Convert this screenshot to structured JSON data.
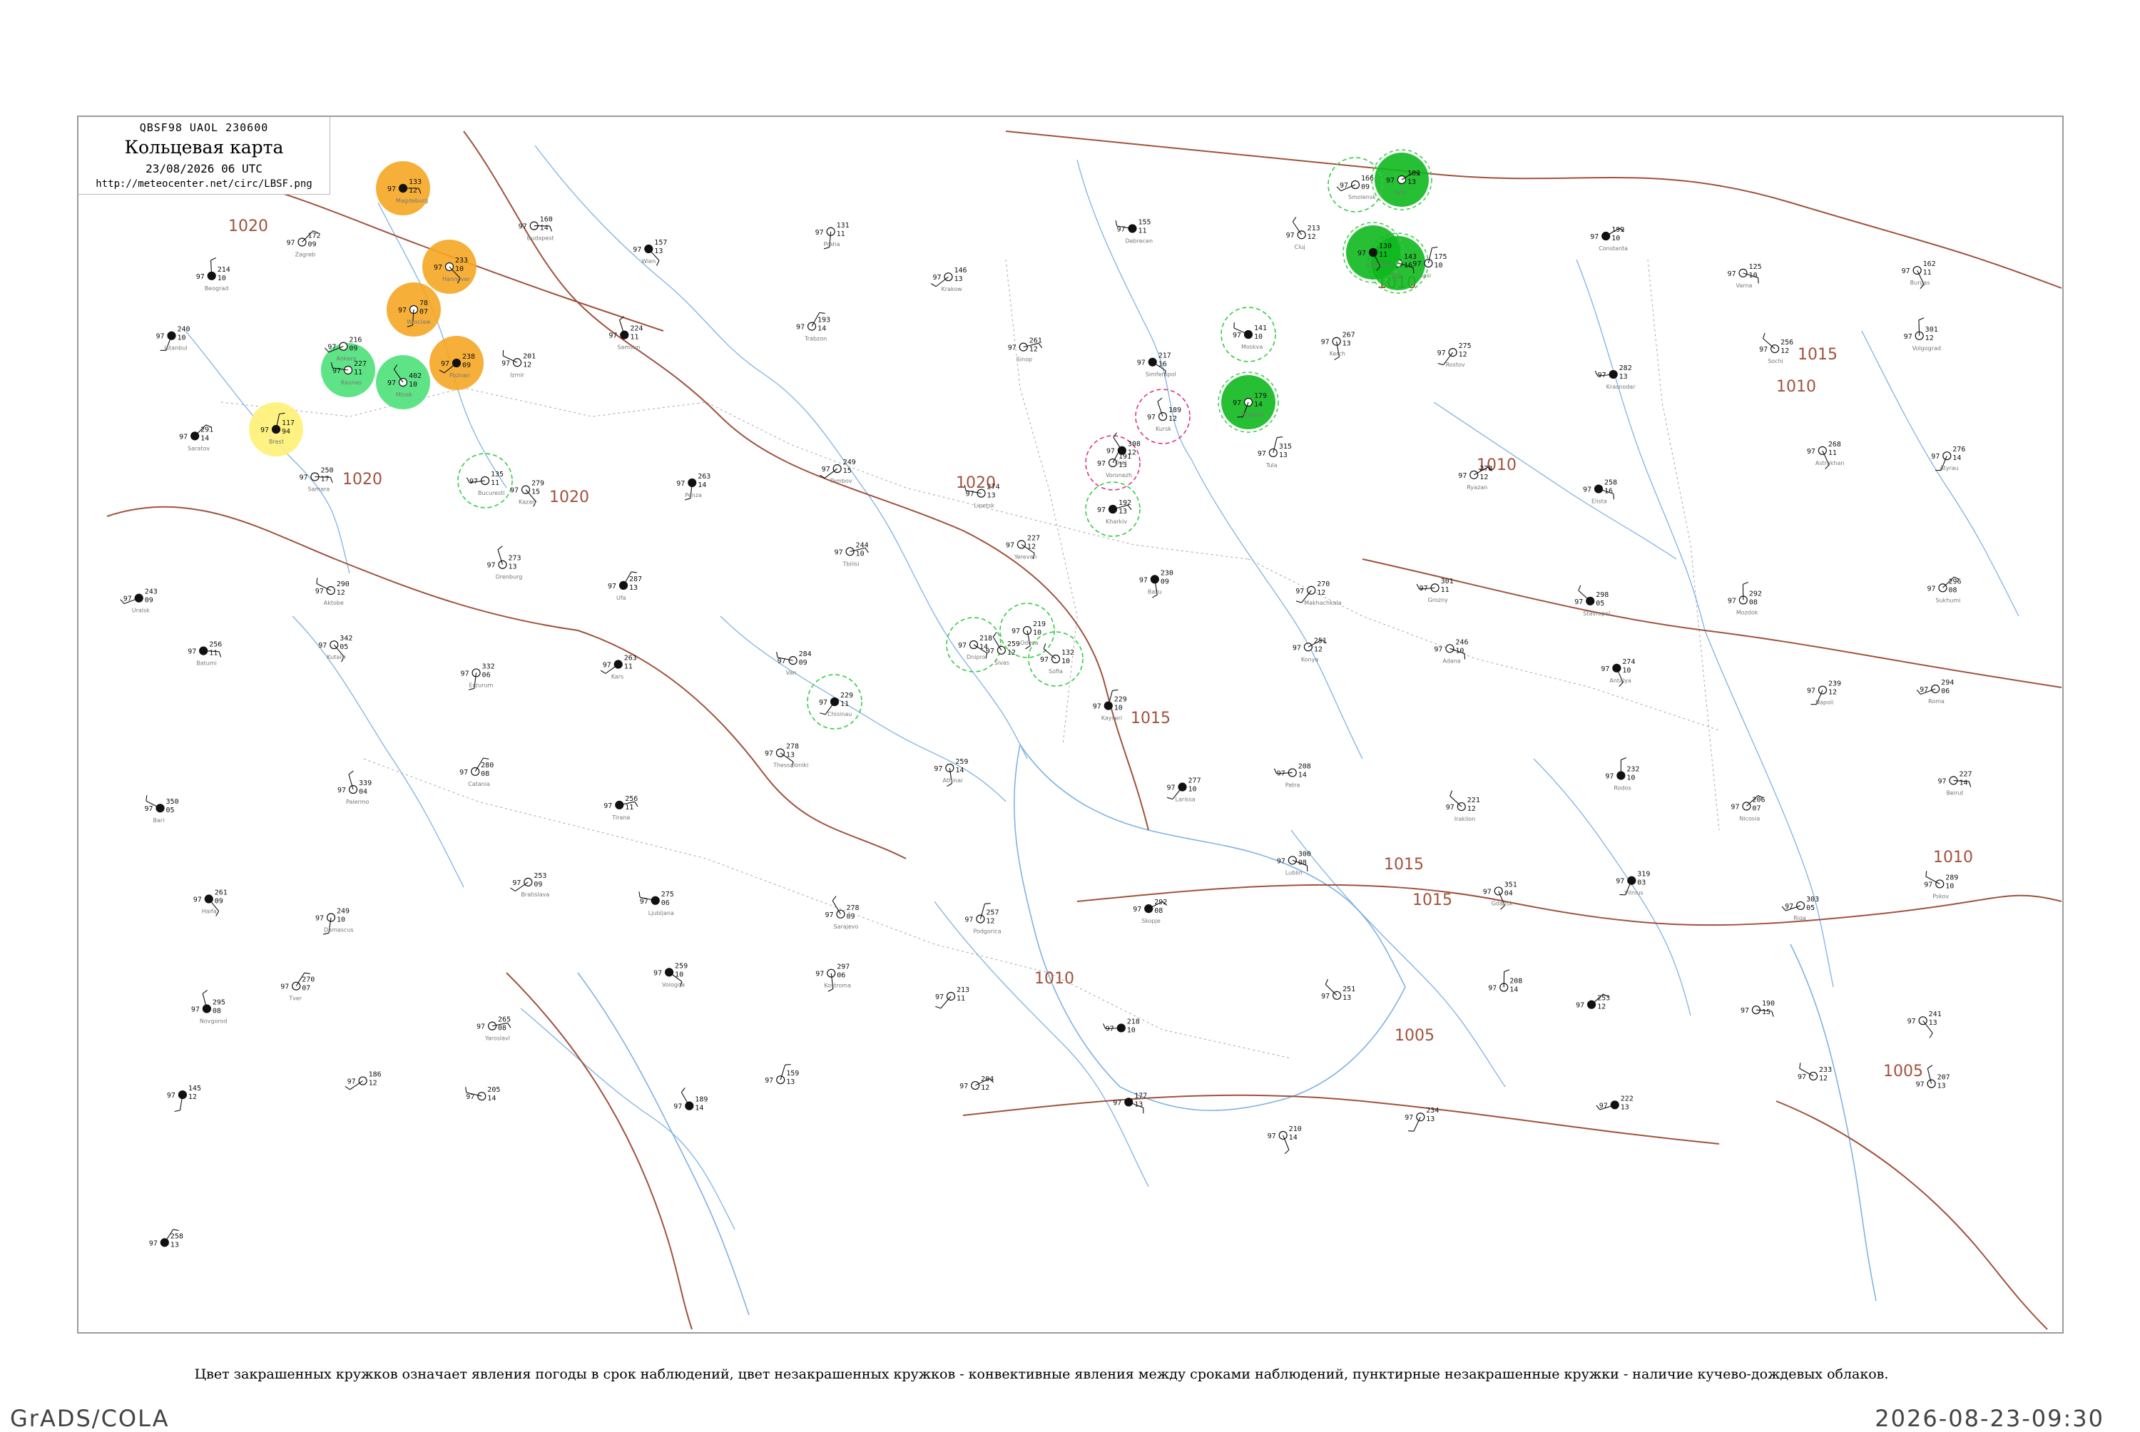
{
  "header": {
    "code": "QBSF98  UAOL  230600",
    "map_name": "Кольцевая карта",
    "datetime": "23/08/2026 06 UTC",
    "url": "http://meteocenter.net/circ/LBSF.png"
  },
  "caption": "Цвет закрашенных кружков означает явления погоды в срок наблюдений, цвет незакрашенных кружков - конвективные явления между сроками наблюдений, пунктирные незакрашенные кружки - наличие кучево-дождевых облаков.",
  "footer": {
    "left": "GrADS/COLA",
    "right": "2026-08-23-09:30"
  },
  "colors": {
    "isobar": "#a0523c",
    "river": "#7fb2e5",
    "border": "#999999",
    "frame": "#9c9c9c",
    "fill_orange": "#f5a623",
    "fill_lightgreen": "#4ee07a",
    "fill_yellow": "#fff176",
    "fill_green": "#0fb81e",
    "ring_green": "#33cc44",
    "ring_magenta": "#dd3388"
  },
  "isobars": [
    {
      "label": "1020"
    },
    {
      "label": "1020"
    },
    {
      "label": "1020"
    },
    {
      "label": "1020"
    },
    {
      "label": "1015"
    },
    {
      "label": "1015"
    },
    {
      "label": "1015"
    },
    {
      "label": "1015"
    },
    {
      "label": "1010"
    },
    {
      "label": "1010"
    },
    {
      "label": "1010"
    },
    {
      "label": "1010"
    },
    {
      "label": "1010"
    },
    {
      "label": "1005"
    },
    {
      "label": "1005"
    }
  ],
  "stations": [
    {
      "p": "133",
      "t": "97",
      "d": "12",
      "c": "orange-fill"
    },
    {
      "p": "233",
      "t": "97",
      "d": "10",
      "c": "orange-fill"
    },
    {
      "p": "78",
      "t": "97",
      "d": "07",
      "c": "orange-fill"
    },
    {
      "p": "238",
      "t": "97",
      "d": "09",
      "c": "orange-fill"
    },
    {
      "p": "227",
      "t": "97",
      "d": "11",
      "c": "lightgreen-fill"
    },
    {
      "p": "402",
      "t": "97",
      "d": "10",
      "c": "lightgreen-fill"
    },
    {
      "p": "117",
      "t": "97",
      "d": "94",
      "c": "yellow-fill"
    },
    {
      "p": "163",
      "t": "97",
      "d": "13",
      "c": "green-fill"
    },
    {
      "p": "143",
      "t": "97",
      "d": "16",
      "c": "green-fill"
    },
    {
      "p": "130",
      "t": "97",
      "d": "11",
      "c": "green-fill"
    },
    {
      "p": "179",
      "t": "97",
      "d": "14",
      "c": "green-fill"
    },
    {
      "p": "166",
      "t": "97",
      "d": "09",
      "c": "ring-green"
    },
    {
      "p": "141",
      "t": "97",
      "d": "10",
      "c": "ring-green"
    },
    {
      "p": "189",
      "t": "97",
      "d": "12",
      "c": "ring-magenta"
    },
    {
      "p": "191",
      "t": "97",
      "d": "13",
      "c": "ring-magenta"
    },
    {
      "p": "192",
      "t": "97",
      "d": "13",
      "c": "ring-green"
    },
    {
      "p": "218",
      "t": "97",
      "d": "14",
      "c": "ring-green"
    },
    {
      "p": "219",
      "t": "97",
      "d": "10",
      "c": "ring-green"
    },
    {
      "p": "229",
      "t": "97",
      "d": "11",
      "c": "ring-green"
    },
    {
      "p": "135",
      "t": "97",
      "d": "11",
      "c": "ring-green"
    },
    {
      "p": "132",
      "t": "97",
      "d": "10",
      "c": "ring-green"
    },
    {
      "p": "214",
      "t": "97",
      "d": "10",
      "c": "plain"
    },
    {
      "p": "172",
      "t": "97",
      "d": "09",
      "c": "plain"
    },
    {
      "p": "160",
      "t": "97",
      "d": "14",
      "c": "plain"
    },
    {
      "p": "157",
      "t": "97",
      "d": "13",
      "c": "plain"
    },
    {
      "p": "131",
      "t": "97",
      "d": "11",
      "c": "plain"
    },
    {
      "p": "146",
      "t": "97",
      "d": "13",
      "c": "plain"
    },
    {
      "p": "155",
      "t": "97",
      "d": "11",
      "c": "plain"
    },
    {
      "p": "213",
      "t": "97",
      "d": "12",
      "c": "plain"
    },
    {
      "p": "175",
      "t": "97",
      "d": "10",
      "c": "plain"
    },
    {
      "p": "199",
      "t": "97",
      "d": "10",
      "c": "plain"
    },
    {
      "p": "125",
      "t": "97",
      "d": "10",
      "c": "plain"
    },
    {
      "p": "162",
      "t": "97",
      "d": "11",
      "c": "plain"
    },
    {
      "p": "240",
      "t": "97",
      "d": "10",
      "c": "plain"
    },
    {
      "p": "216",
      "t": "97",
      "d": "09",
      "c": "plain"
    },
    {
      "p": "201",
      "t": "97",
      "d": "12",
      "c": "plain"
    },
    {
      "p": "224",
      "t": "97",
      "d": "11",
      "c": "plain"
    },
    {
      "p": "193",
      "t": "97",
      "d": "14",
      "c": "plain"
    },
    {
      "p": "261",
      "t": "97",
      "d": "12",
      "c": "plain"
    },
    {
      "p": "217",
      "t": "97",
      "d": "16",
      "c": "plain"
    },
    {
      "p": "267",
      "t": "97",
      "d": "13",
      "c": "plain"
    },
    {
      "p": "275",
      "t": "97",
      "d": "12",
      "c": "plain"
    },
    {
      "p": "282",
      "t": "97",
      "d": "13",
      "c": "plain"
    },
    {
      "p": "256",
      "t": "97",
      "d": "12",
      "c": "plain"
    },
    {
      "p": "301",
      "t": "97",
      "d": "12",
      "c": "plain"
    },
    {
      "p": "291",
      "t": "97",
      "d": "14",
      "c": "plain"
    },
    {
      "p": "250",
      "t": "97",
      "d": "17",
      "c": "plain"
    },
    {
      "p": "279",
      "t": "97",
      "d": "15",
      "c": "plain"
    },
    {
      "p": "263",
      "t": "97",
      "d": "14",
      "c": "plain"
    },
    {
      "p": "249",
      "t": "97",
      "d": "15",
      "c": "plain"
    },
    {
      "p": "274",
      "t": "97",
      "d": "13",
      "c": "plain"
    },
    {
      "p": "308",
      "t": "97",
      "d": "12",
      "c": "plain"
    },
    {
      "p": "315",
      "t": "97",
      "d": "13",
      "c": "plain"
    },
    {
      "p": "278",
      "t": "97",
      "d": "12",
      "c": "plain"
    },
    {
      "p": "258",
      "t": "97",
      "d": "16",
      "c": "plain"
    },
    {
      "p": "268",
      "t": "97",
      "d": "11",
      "c": "plain"
    },
    {
      "p": "276",
      "t": "97",
      "d": "14",
      "c": "plain"
    },
    {
      "p": "243",
      "t": "97",
      "d": "09",
      "c": "plain"
    },
    {
      "p": "290",
      "t": "97",
      "d": "12",
      "c": "plain"
    },
    {
      "p": "273",
      "t": "97",
      "d": "13",
      "c": "plain"
    },
    {
      "p": "287",
      "t": "97",
      "d": "13",
      "c": "plain"
    },
    {
      "p": "244",
      "t": "97",
      "d": "10",
      "c": "plain"
    },
    {
      "p": "227",
      "t": "97",
      "d": "12",
      "c": "plain"
    },
    {
      "p": "230",
      "t": "97",
      "d": "09",
      "c": "plain"
    },
    {
      "p": "270",
      "t": "97",
      "d": "12",
      "c": "plain"
    },
    {
      "p": "301",
      "t": "97",
      "d": "11",
      "c": "plain"
    },
    {
      "p": "298",
      "t": "97",
      "d": "05",
      "c": "plain"
    },
    {
      "p": "292",
      "t": "97",
      "d": "08",
      "c": "plain"
    },
    {
      "p": "296",
      "t": "97",
      "d": "08",
      "c": "plain"
    },
    {
      "p": "256",
      "t": "97",
      "d": "11",
      "c": "plain"
    },
    {
      "p": "342",
      "t": "97",
      "d": "05",
      "c": "plain"
    },
    {
      "p": "332",
      "t": "97",
      "d": "06",
      "c": "plain"
    },
    {
      "p": "263",
      "t": "97",
      "d": "11",
      "c": "plain"
    },
    {
      "p": "284",
      "t": "97",
      "d": "09",
      "c": "plain"
    },
    {
      "p": "259",
      "t": "97",
      "d": "12",
      "c": "plain"
    },
    {
      "p": "229",
      "t": "97",
      "d": "10",
      "c": "plain"
    },
    {
      "p": "251",
      "t": "97",
      "d": "12",
      "c": "plain"
    },
    {
      "p": "246",
      "t": "97",
      "d": "10",
      "c": "plain"
    },
    {
      "p": "274",
      "t": "97",
      "d": "10",
      "c": "plain"
    },
    {
      "p": "239",
      "t": "97",
      "d": "12",
      "c": "plain"
    },
    {
      "p": "294",
      "t": "97",
      "d": "06",
      "c": "plain"
    },
    {
      "p": "350",
      "t": "97",
      "d": "05",
      "c": "plain"
    },
    {
      "p": "339",
      "t": "97",
      "d": "04",
      "c": "plain"
    },
    {
      "p": "280",
      "t": "97",
      "d": "08",
      "c": "plain"
    },
    {
      "p": "256",
      "t": "97",
      "d": "11",
      "c": "plain"
    },
    {
      "p": "278",
      "t": "97",
      "d": "13",
      "c": "plain"
    },
    {
      "p": "259",
      "t": "97",
      "d": "14",
      "c": "plain"
    },
    {
      "p": "277",
      "t": "97",
      "d": "10",
      "c": "plain"
    },
    {
      "p": "208",
      "t": "97",
      "d": "14",
      "c": "plain"
    },
    {
      "p": "221",
      "t": "97",
      "d": "12",
      "c": "plain"
    },
    {
      "p": "232",
      "t": "97",
      "d": "10",
      "c": "plain"
    },
    {
      "p": "206",
      "t": "97",
      "d": "07",
      "c": "plain"
    },
    {
      "p": "227",
      "t": "97",
      "d": "14",
      "c": "plain"
    },
    {
      "p": "261",
      "t": "97",
      "d": "09",
      "c": "plain"
    },
    {
      "p": "249",
      "t": "97",
      "d": "10",
      "c": "plain"
    },
    {
      "p": "253",
      "t": "97",
      "d": "09",
      "c": "plain"
    },
    {
      "p": "275",
      "t": "97",
      "d": "06",
      "c": "plain"
    },
    {
      "p": "278",
      "t": "97",
      "d": "09",
      "c": "plain"
    },
    {
      "p": "257",
      "t": "97",
      "d": "12",
      "c": "plain"
    },
    {
      "p": "292",
      "t": "97",
      "d": "08",
      "c": "plain"
    },
    {
      "p": "300",
      "t": "97",
      "d": "08",
      "c": "plain"
    },
    {
      "p": "351",
      "t": "97",
      "d": "04",
      "c": "plain"
    },
    {
      "p": "319",
      "t": "97",
      "d": "03",
      "c": "plain"
    },
    {
      "p": "303",
      "t": "97",
      "d": "05",
      "c": "plain"
    },
    {
      "p": "289",
      "t": "97",
      "d": "10",
      "c": "plain"
    },
    {
      "p": "295",
      "t": "97",
      "d": "08",
      "c": "plain"
    },
    {
      "p": "270",
      "t": "97",
      "d": "07",
      "c": "plain"
    },
    {
      "p": "265",
      "t": "97",
      "d": "08",
      "c": "plain"
    },
    {
      "p": "259",
      "t": "97",
      "d": "10",
      "c": "plain"
    },
    {
      "p": "297",
      "t": "97",
      "d": "06",
      "c": "plain"
    },
    {
      "p": "213",
      "t": "97",
      "d": "11",
      "c": "plain"
    },
    {
      "p": "218",
      "t": "97",
      "d": "10",
      "c": "plain"
    },
    {
      "p": "251",
      "t": "97",
      "d": "13",
      "c": "plain"
    },
    {
      "p": "208",
      "t": "97",
      "d": "14",
      "c": "plain"
    },
    {
      "p": "253",
      "t": "97",
      "d": "12",
      "c": "plain"
    },
    {
      "p": "190",
      "t": "97",
      "d": "15",
      "c": "plain"
    },
    {
      "p": "241",
      "t": "97",
      "d": "13",
      "c": "plain"
    },
    {
      "p": "145",
      "t": "97",
      "d": "12",
      "c": "plain"
    },
    {
      "p": "186",
      "t": "97",
      "d": "12",
      "c": "plain"
    },
    {
      "p": "205",
      "t": "97",
      "d": "14",
      "c": "plain"
    },
    {
      "p": "189",
      "t": "97",
      "d": "14",
      "c": "plain"
    },
    {
      "p": "159",
      "t": "97",
      "d": "13",
      "c": "plain"
    },
    {
      "p": "204",
      "t": "97",
      "d": "12",
      "c": "plain"
    },
    {
      "p": "177",
      "t": "97",
      "d": "13",
      "c": "plain"
    },
    {
      "p": "210",
      "t": "97",
      "d": "14",
      "c": "plain"
    },
    {
      "p": "234",
      "t": "97",
      "d": "13",
      "c": "plain"
    },
    {
      "p": "222",
      "t": "97",
      "d": "13",
      "c": "plain"
    },
    {
      "p": "233",
      "t": "97",
      "d": "12",
      "c": "plain"
    },
    {
      "p": "207",
      "t": "97",
      "d": "13",
      "c": "plain"
    },
    {
      "p": "258",
      "t": "97",
      "d": "13",
      "c": "plain"
    }
  ],
  "station_names": [
    "Magdeburg",
    "Hannover",
    "Wroclaw",
    "Poznan",
    "Kaunas",
    "Minsk",
    "Brest",
    "Lviv",
    "Kyiv",
    "Chernihiv",
    "Bryansk",
    "Smolensk",
    "Moskva",
    "Kursk",
    "Voronezh",
    "Kharkiv",
    "Dnipro",
    "Odesa",
    "Chisinau",
    "Bucuresti",
    "Sofia",
    "Beograd",
    "Zagreb",
    "Budapest",
    "Wien",
    "Praha",
    "Krakow",
    "Debrecen",
    "Cluj",
    "Iasi",
    "Constanta",
    "Varna",
    "Burgas",
    "Istanbul",
    "Ankara",
    "Izmir",
    "Samsun",
    "Trabzon",
    "Sinop",
    "Simferopol",
    "Kerch",
    "Rostov",
    "Krasnodar",
    "Sochi",
    "Volgograd",
    "Saratov",
    "Samara",
    "Kazan",
    "Penza",
    "Tambov",
    "Lipetsk",
    "Orel",
    "Tula",
    "Ryazan",
    "Elista",
    "Astrakhan",
    "Atyrau",
    "Uralsk",
    "Aktobe",
    "Orenburg",
    "Ufa",
    "Tbilisi",
    "Yerevan",
    "Baku",
    "Makhachkala",
    "Grozny",
    "Stavropol",
    "Mozdok",
    "Sukhumi",
    "Batumi",
    "Kutaisi",
    "Erzurum",
    "Kars",
    "Van",
    "Sivas",
    "Kayseri",
    "Konya",
    "Adana",
    "Antalya",
    "Napoli",
    "Roma",
    "Bari",
    "Palermo",
    "Catania",
    "Tirana",
    "Thessaloniki",
    "Athinai",
    "Larissa",
    "Patra",
    "Iraklion",
    "Rodos",
    "Nicosia",
    "Beirut",
    "Haifa",
    "Damascus",
    "Bratislava",
    "Ljubljana",
    "Sarajevo",
    "Podgorica",
    "Skopje",
    "Lublin",
    "Gdansk",
    "Vilnius",
    "Riga",
    "Pskov",
    "Novgorod",
    "Tver",
    "Yaroslavl",
    "Vologda",
    "Kostroma"
  ]
}
